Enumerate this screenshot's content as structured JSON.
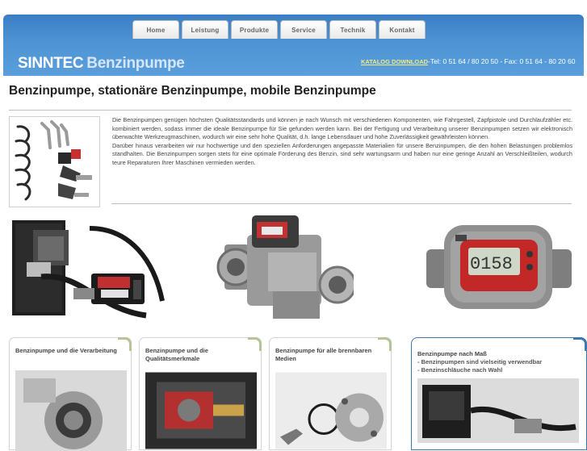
{
  "nav": {
    "items": [
      {
        "label": "Home"
      },
      {
        "label": "Leistung"
      },
      {
        "label": "Produkte"
      },
      {
        "label": "Service"
      },
      {
        "label": "Technik"
      },
      {
        "label": "Kontakt"
      }
    ]
  },
  "header": {
    "brand": "SINNTEC",
    "brand_sub": "Benzinpumpe",
    "katalog_link": "KATALOG DOWNLOAD",
    "contact": "-Tel: 0 51 64 / 80 20 50 - Fax: 0 51 64 - 80 20 60"
  },
  "page": {
    "title": "Benzinpumpe, stationäre Benzinpumpe, mobile Benzinpumpe",
    "intro_p1": "Die Benzinpumpen genügen höchsten Qualitätsstandards und können je nach Wunsch mit verschiedenen Komponenten, wie Fahrgestell, Zapfpistole und Durchlaufzähler etc. kombiniert werden, sodass immer die ideale Benzinpumpe für Sie gefunden werden kann. Bei der Fertigung und Verarbeitung unserer Benzinpumpen setzen wir elektronisch überwachte Werkzeugmaschinen, wodurch wir eine sehr hohe Qualität, d.h. lange Lebensdauer und hohe Zuverlässigkeit gewährleisten können.",
    "intro_p2": "Darüber hinaus verarbeiten wir nur hochwertige und den speziellen Anforderungen angepasste Materialien für unsere Benzinpumpen, die den hohen Belastungen problemlos standhalten. Die Benzinpumpen sorgen stets für eine optimale Förderung des Benzin, sind sehr wartungsarm und haben nur eine geringe Anzahl an Verschleißteilen, wodurch teure Reparaturen Ihrer Maschinen vermieden werden."
  },
  "display": {
    "readout": "0158"
  },
  "cards": [
    {
      "title": "Benzinpumpe und die Verarbeitung"
    },
    {
      "title": "Benzinpumpe und die Qualitätsmerkmale"
    },
    {
      "title": "Benzinpumpe für alle brennbaren Medien"
    },
    {
      "title": "Benzinpumpe nach Maß",
      "line1": "- Benzinpumpen sind vielseitig verwendbar",
      "line2": "- Benzinschläuche nach Wahl"
    }
  ],
  "colors": {
    "header_blue": "#4e93d3",
    "katalog_yellow": "#f6ea7a",
    "card_accent": "#3e78b0"
  }
}
